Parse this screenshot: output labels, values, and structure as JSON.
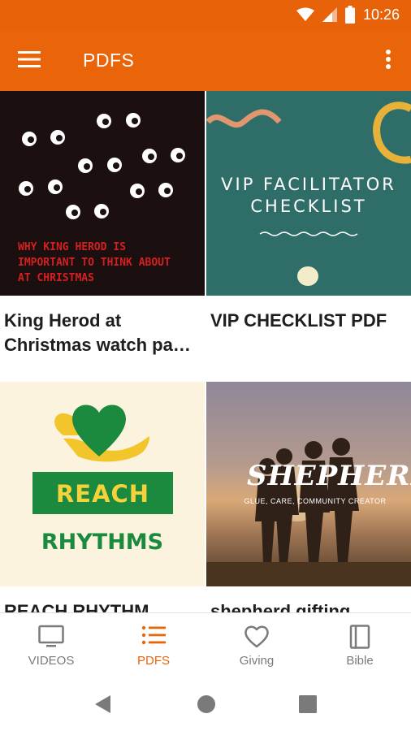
{
  "status_bar": {
    "time": "10:26",
    "icons": [
      "wifi-icon",
      "signal-icon",
      "battery-icon"
    ]
  },
  "app_bar": {
    "title": "PDFS",
    "menu_icon": "menu-icon",
    "more_icon": "more-vert-icon"
  },
  "cards": [
    {
      "title": "King Herod at Christmas watch pa…",
      "thumb_text": [
        "WHY KING HEROD IS",
        "IMPORTANT TO THINK ABOUT",
        "AT CHRISTMAS"
      ]
    },
    {
      "title": "VIP CHECKLIST PDF",
      "thumb_text": [
        "VIP FACILITATOR",
        "CHECKLIST"
      ]
    },
    {
      "title": "REACH RHYTHM",
      "thumb_text": [
        "REACH",
        "RHYTHMS"
      ]
    },
    {
      "title": "shepherd gifting",
      "thumb_text": [
        "SHEPHERD",
        "GLUE, CARE, COMMUNITY CREATOR"
      ]
    }
  ],
  "bottom_nav": [
    {
      "label": "VIDEOS",
      "icon": "tv-icon",
      "active": false
    },
    {
      "label": "PDFS",
      "icon": "list-icon",
      "active": true
    },
    {
      "label": "Giving",
      "icon": "heart-icon",
      "active": false
    },
    {
      "label": "Bible",
      "icon": "book-icon",
      "active": false
    }
  ],
  "colors": {
    "accent": "#ea640a",
    "status_bar": "#e8620a",
    "inactive": "#7a7a7a"
  }
}
